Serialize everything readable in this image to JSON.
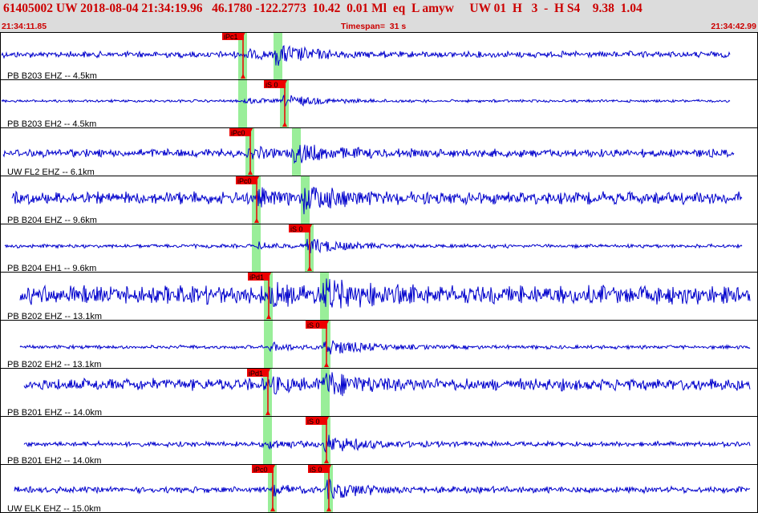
{
  "header": {
    "title": "61405002 UW 2018-08-04 21:34:19.96   46.1780 -122.2773  10.42  0.01 Ml  eq  L amyw     UW 01  H   3  -  H S4    9.38  1.04",
    "start_time": "21:34:11.85",
    "timespan": "Timespan=  31 s",
    "end_time": "21:34:42.99"
  },
  "colors": {
    "waveform": "#0000cc",
    "window": "#99ee99",
    "pick": "#ee0000",
    "pick_text": "#000000",
    "grid": "#000000",
    "header_bg": "#dcdcdc",
    "header_text": "#cc0000"
  },
  "traces": [
    {
      "label": "PB B203 EHZ -- 4.5km",
      "p_pick": "iPc1",
      "amp": 3,
      "burst": 11
    },
    {
      "label": "PB B203 EH2 -- 4.5km",
      "s_pick": "iS 0",
      "amp": 1.3,
      "burst": 7
    },
    {
      "label": "UW FL2 EHZ -- 6.1km",
      "p_pick": "iPc0",
      "amp": 4,
      "burst": 10
    },
    {
      "label": "PB B204 EHZ -- 9.6km",
      "p_pick": "iPc0",
      "amp": 6,
      "burst": 13
    },
    {
      "label": "PB B204 EH1 -- 9.6km",
      "s_pick": "iS 0",
      "amp": 1.8,
      "burst": 9
    },
    {
      "label": "PB B202 EHZ -- 13.1km",
      "p_pick": "iPd1",
      "amp": 9,
      "burst": 15
    },
    {
      "label": "PB B202 EH2 -- 13.1km",
      "s_pick": "iS 0",
      "amp": 1.8,
      "burst": 10
    },
    {
      "label": "PB B201 EHZ -- 14.0km",
      "p_pick": "iPd1",
      "amp": 6,
      "burst": 12
    },
    {
      "label": "PB B201 EH2 -- 14.0km",
      "s_pick": "iS 0",
      "amp": 2.5,
      "burst": 10
    },
    {
      "label": "UW ELK EHZ -- 15.0km",
      "p_pick": "iPc0",
      "s_pick": "iS 0",
      "amp": 3,
      "burst": 10
    }
  ]
}
